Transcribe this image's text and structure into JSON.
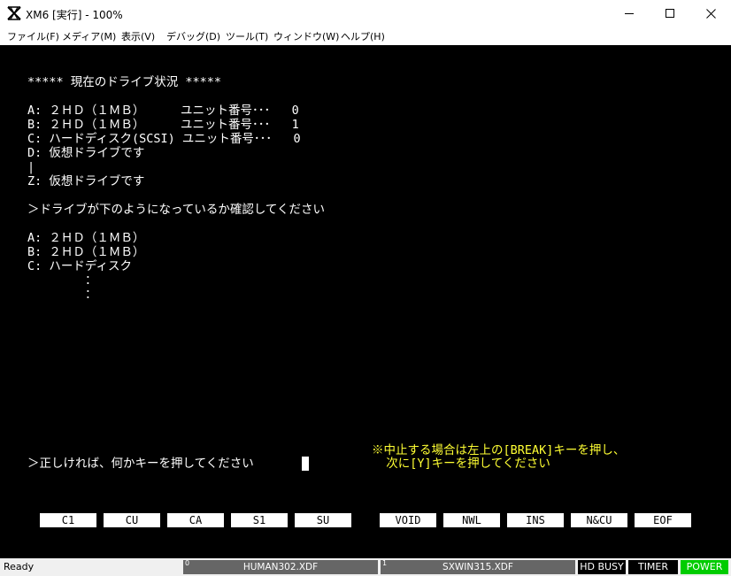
{
  "window": {
    "title": "XM6 [実行] - 100%",
    "minimize": "—",
    "maximize": "☐",
    "close": "✕"
  },
  "menu": [
    "ファイル(F)",
    "メディア(M)",
    "表示(V)",
    "デバッグ(D)",
    "ツール(T)",
    "ウィンドウ(W)",
    "ヘルプ(H)"
  ],
  "screen": {
    "lines": [
      "***** 現在のドライブ状況 *****",
      "A: ２ＨＤ（１ＭＢ）     ユニット番号･･･   0",
      "B: ２ＨＤ（１ＭＢ）     ユニット番号･･･   1",
      "C: ハードディスク(SCSI) ユニット番号･･･   0",
      "D: 仮想ドライブです",
      "|",
      "Z: 仮想ドライブです",
      "＞ドライブが下のようになっているか確認してください",
      "A: ２ＨＤ（１ＭＢ）",
      "B: ２ＨＤ（１ＭＢ）",
      "C: ハードディスク",
      "        ：",
      "        ：",
      "＞正しければ、何かキーを押してください"
    ],
    "notice": [
      "※中止する場合は左上の[BREAK]キーを押し、",
      "  次に[Y]キーを押してください"
    ],
    "function_keys": [
      "C1",
      "CU",
      "CA",
      "S1",
      "SU",
      "VOID",
      "NWL",
      "INS",
      "N&CU",
      "EOF"
    ]
  },
  "status": {
    "ready": "Ready",
    "drive0_num": "0",
    "drive0": "HUMAN302.XDF",
    "drive1_num": "1",
    "drive1": "SXWIN315.XDF",
    "hd_busy": "HD BUSY",
    "timer": "TIMER",
    "power": "POWER"
  },
  "colors": {
    "screen_bg": "#000000",
    "text": "#ffffff",
    "notice": "#ffff33",
    "power_on": "#00cc00",
    "indicator_off": "#000000"
  }
}
